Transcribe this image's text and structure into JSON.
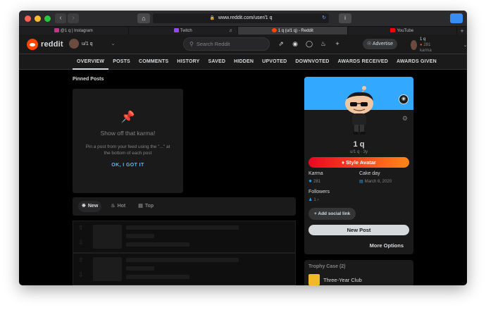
{
  "browser": {
    "url": "www.reddit.com/user/1 q",
    "tabs": [
      {
        "label": "@1   q | Instagram",
        "icon_color": "#c13584",
        "active": false
      },
      {
        "label": "Twitch",
        "icon_color": "#9146ff",
        "active": false
      },
      {
        "label": "1   q (u/1   q) - Reddit",
        "icon_color": "#ff4500",
        "active": true
      },
      {
        "label": "YouTube",
        "icon_color": "#ff0000",
        "active": false
      }
    ]
  },
  "header": {
    "logo_text": "reddit",
    "username": "u/1   q",
    "search_placeholder": "Search Reddit",
    "advertise_label": "Advertise",
    "account_name": "1   q",
    "account_karma": "281 karma"
  },
  "profile_tabs": [
    "OVERVIEW",
    "POSTS",
    "COMMENTS",
    "HISTORY",
    "SAVED",
    "HIDDEN",
    "UPVOTED",
    "DOWNVOTED",
    "AWARDS RECEIVED",
    "AWARDS GIVEN"
  ],
  "pinned": {
    "section_title": "Pinned Posts",
    "heading": "Show off that karma!",
    "description": "Pin a post from your feed using the \"...\" at the bottom of each post",
    "ok_label": "OK, I GOT IT"
  },
  "sort": {
    "new_label": "New",
    "hot_label": "Hot",
    "top_label": "Top"
  },
  "profile_card": {
    "display_name": "1    q",
    "subtitle": "u/1   q · 3y",
    "style_avatar_label": "Style Avatar",
    "karma_label": "Karma",
    "karma_value": "281",
    "cakeday_label": "Cake day",
    "cakeday_value": "March 6, 2020",
    "followers_label": "Followers",
    "followers_value": "1",
    "add_social_label": "Add social link",
    "new_post_label": "New Post",
    "more_options_label": "More Options"
  },
  "trophy_case": {
    "title": "Trophy Case (2)",
    "first_trophy": "Three-Year Club"
  },
  "colors": {
    "brand": "#ff4500",
    "banner": "#33a8ff",
    "link": "#4fbcff"
  }
}
